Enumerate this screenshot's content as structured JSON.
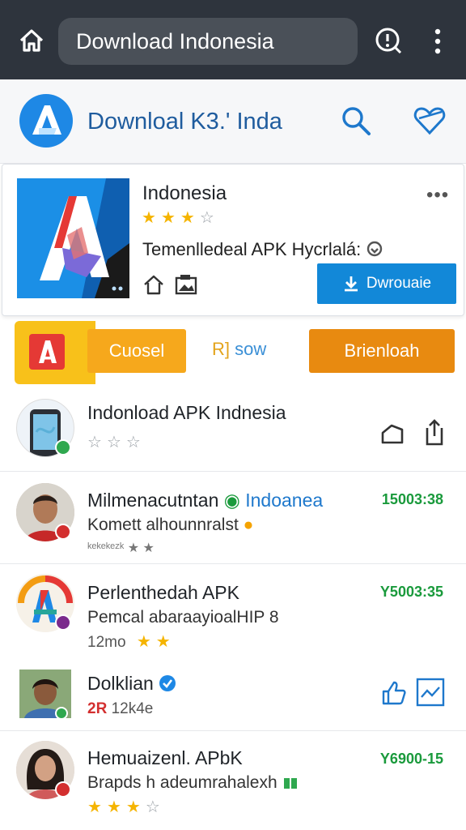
{
  "browser": {
    "url_text": "Download Indonesia"
  },
  "site": {
    "name": "Downloal K3.' Inda",
    "colors": {
      "brand": "#1e88e5",
      "accent_orange": "#e88a10",
      "accent_yellow": "#f8c11a",
      "time_green": "#1a9a3c"
    }
  },
  "featured": {
    "title": "Indonesia",
    "more": "•••",
    "rating": 3,
    "rating_max": 4,
    "description": "Temenlledeal APK Hycrlalá: ",
    "download_label": "Dwrouaie"
  },
  "strip": {
    "cuosel": "Cuosel",
    "rj": "R]",
    "sow": " sow",
    "brenloah": "Brienloah"
  },
  "list": [
    {
      "title": "Indonload APK Indnesia",
      "rating": 0,
      "rating_max": 3
    },
    {
      "title": "Milmenacutntan ",
      "title_accent": "Indoanea",
      "subtitle": "Komett alhounnralst ",
      "meta": "ᵏᵉᵏᵉᵏᵉᶻᵏ ★ ★",
      "time": "15003:38"
    },
    {
      "title": "Perlenthedah APK",
      "subtitle": "Pemcal abaraayioalHIP 8",
      "meta": "12mo",
      "rating": 2,
      "time": "Y5003:35"
    },
    {
      "title": "Dolklian",
      "meta_red": "2R",
      "meta": " 12k4e"
    },
    {
      "title": "Hemuaizenl. APbK",
      "subtitle": "Brapds h adeumrahalexh",
      "rating": 3,
      "rating_max": 4,
      "time": "Y6900-15"
    }
  ]
}
